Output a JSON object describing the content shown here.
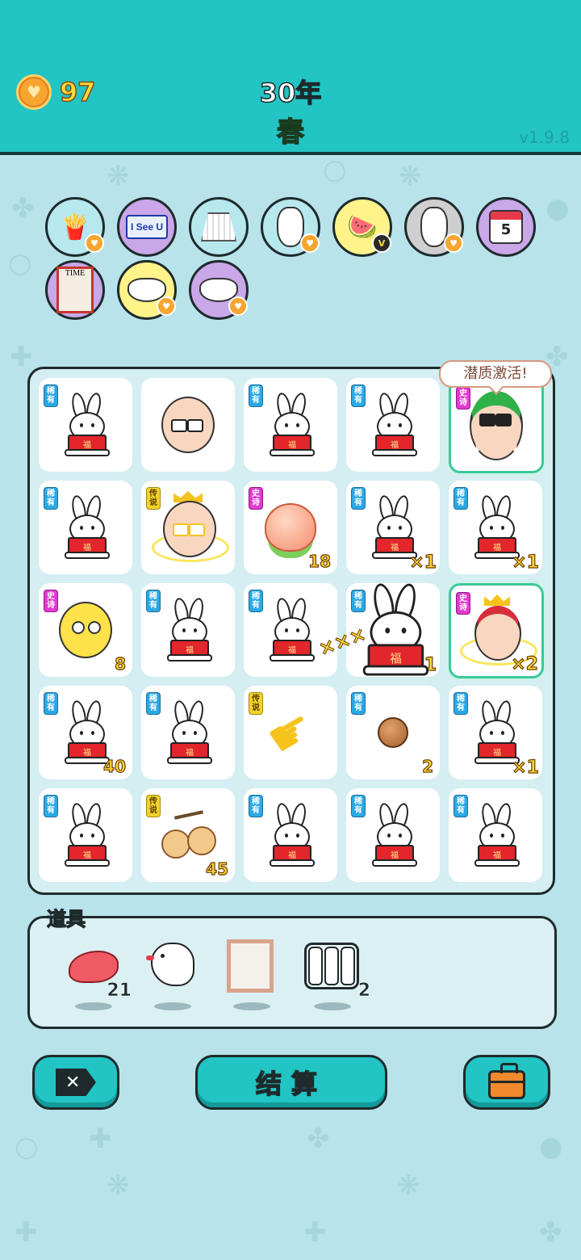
{
  "header": {
    "coins": "97",
    "year": "30年",
    "season": "春",
    "version": "v1.9.8"
  },
  "buffs": [
    {
      "icon": "fries-icon",
      "bg": "#b6e8ee",
      "badge": true
    },
    {
      "icon": "i-see-u-icon",
      "text": "I See U",
      "bg": "#c9a7e8",
      "badge": false
    },
    {
      "icon": "skirt-icon",
      "bg": "#b6e8ee",
      "badge": false
    },
    {
      "icon": "bunny-icon",
      "bg": "#b6e8ee",
      "badge": true
    },
    {
      "icon": "fruit-basket-icon",
      "bg": "#fff38a",
      "badge": "V"
    },
    {
      "icon": "gray-bunny-icon",
      "bg": "#cfcfcf",
      "badge": true
    },
    {
      "icon": "calendar-icon",
      "text": "5",
      "bg": "#c9a7e8",
      "badge": false
    },
    {
      "icon": "time-magazine-icon",
      "text": "TIME",
      "bg": "#c9a7e8",
      "badge": false
    },
    {
      "icon": "rice-bowl-icon",
      "bg": "#fff38a",
      "badge": true
    },
    {
      "icon": "rice-bowl-icon",
      "bg": "#c9a7e8",
      "badge": true
    }
  ],
  "tags": {
    "rare": "稀有",
    "epic": "史诗",
    "legend": "传说"
  },
  "bubble": "潜质激活!",
  "board": [
    {
      "type": "bunny",
      "tag": "rare"
    },
    {
      "type": "old-man",
      "tag": ""
    },
    {
      "type": "bunny",
      "tag": "rare"
    },
    {
      "type": "bunny",
      "tag": "rare"
    },
    {
      "type": "green-hat-man",
      "tag": "epic",
      "highlight": true
    },
    {
      "type": "bunny",
      "tag": "rare"
    },
    {
      "type": "king",
      "tag": "legend"
    },
    {
      "type": "peach",
      "tag": "epic",
      "num": "18"
    },
    {
      "type": "bunny",
      "tag": "rare",
      "mult": "×1"
    },
    {
      "type": "bunny",
      "tag": "rare",
      "mult": "×1"
    },
    {
      "type": "chick",
      "tag": "epic",
      "num": "8"
    },
    {
      "type": "bunny",
      "tag": "rare"
    },
    {
      "type": "bunny",
      "tag": "rare"
    },
    {
      "type": "bunny",
      "tag": "rare",
      "mult": "×1"
    },
    {
      "type": "queen",
      "tag": "epic",
      "mult": "×2",
      "highlight": true
    },
    {
      "type": "bunny",
      "tag": "rare",
      "num": "40"
    },
    {
      "type": "bunny",
      "tag": "rare"
    },
    {
      "type": "pointer-hand",
      "tag": "legend"
    },
    {
      "type": "nut",
      "tag": "rare",
      "num": "2"
    },
    {
      "type": "bunny",
      "tag": "rare",
      "mult": "×1"
    },
    {
      "type": "bunny",
      "tag": "rare"
    },
    {
      "type": "longans",
      "tag": "legend",
      "num": "45"
    },
    {
      "type": "bunny",
      "tag": "rare"
    },
    {
      "type": "bunny",
      "tag": "rare"
    },
    {
      "type": "bunny",
      "tag": "rare"
    }
  ],
  "items": {
    "title": "道具",
    "list": [
      {
        "icon": "liver-icon",
        "count": "21"
      },
      {
        "icon": "white-bird-icon",
        "count": ""
      },
      {
        "icon": "picture-frame-icon",
        "count": ""
      },
      {
        "icon": "bars-frame-icon",
        "count": "2"
      }
    ]
  },
  "buttons": {
    "remove_icon": "remove-icon",
    "settle_label": "结算",
    "bag_icon": "briefcase-icon"
  },
  "colors": {
    "header": "#22c4c4",
    "background": "#b9e3ea",
    "coin_text": "#ffd83a",
    "season_text": "#2ed14a"
  }
}
